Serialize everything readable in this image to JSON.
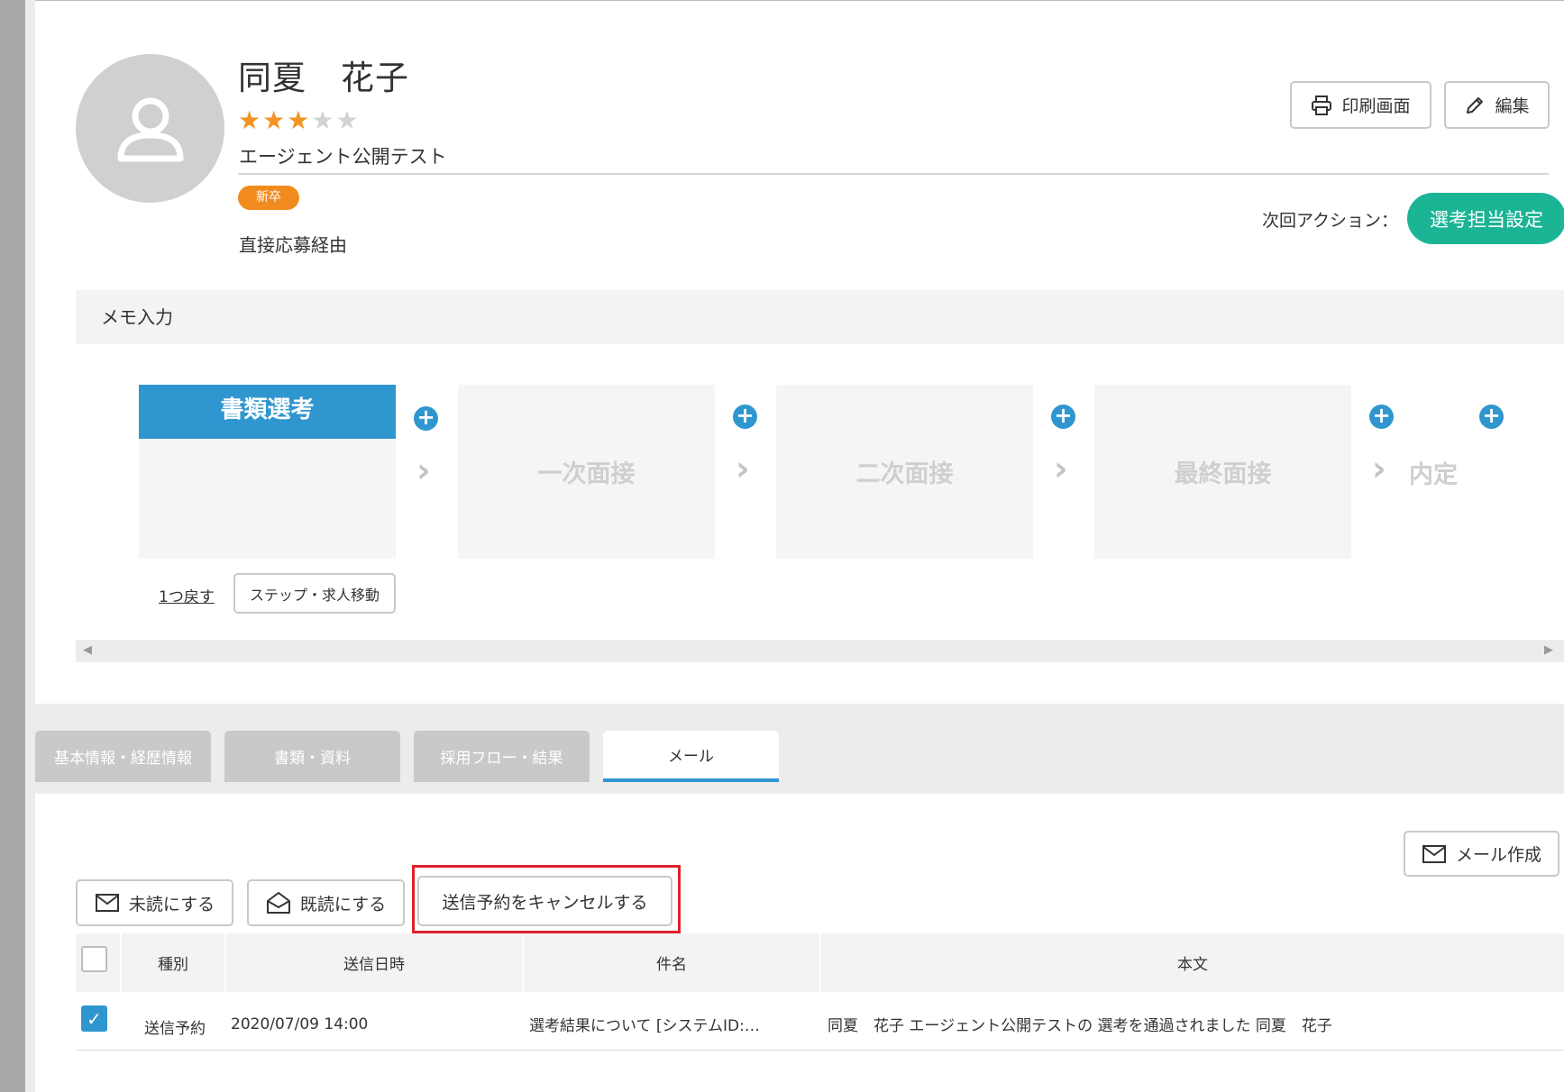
{
  "candidate": {
    "name": "同夏　花子",
    "rating": 3,
    "rating_max": 5,
    "stars_on": "★★★",
    "stars_off": "★★",
    "company": "エージェント公開テスト",
    "badge": "新卒",
    "source": "直接応募経由"
  },
  "header_actions": {
    "print_label": "印刷画面",
    "edit_label": "編集",
    "next_action_label": "次回アクション：",
    "assign_button": "選考担当設定"
  },
  "memo": {
    "label": "メモ入力"
  },
  "flow": {
    "stages": [
      "書類選考",
      "一次面接",
      "二次面接",
      "最終面接",
      "内定"
    ],
    "current_stage": "書類選考",
    "back_link": "1つ戻す",
    "move_button": "ステップ・求人移動"
  },
  "tabs": [
    {
      "label": "基本情報・経歴情報",
      "active": false
    },
    {
      "label": "書類・資料",
      "active": false
    },
    {
      "label": "採用フロー・結果",
      "active": false
    },
    {
      "label": "メール",
      "active": true
    }
  ],
  "mail": {
    "compose_label": "メール作成",
    "mark_unread_label": "未読にする",
    "mark_read_label": "既読にする",
    "cancel_schedule_label": "送信予約をキャンセルする",
    "columns": [
      "種別",
      "送信日時",
      "件名",
      "本文"
    ],
    "rows": [
      {
        "checked": true,
        "type": "送信予約",
        "sent_at": "2020/07/09 14:00",
        "subject": "選考結果について [システムID:…",
        "body": "同夏　花子 エージェント公開テストの 選考を通過されました 同夏　花子"
      }
    ]
  },
  "colors": {
    "accent_blue": "#2f96cf",
    "teal": "#1bb494",
    "star": "#f29322",
    "badge": "#f28b1e",
    "highlight_frame": "#e0202a"
  }
}
